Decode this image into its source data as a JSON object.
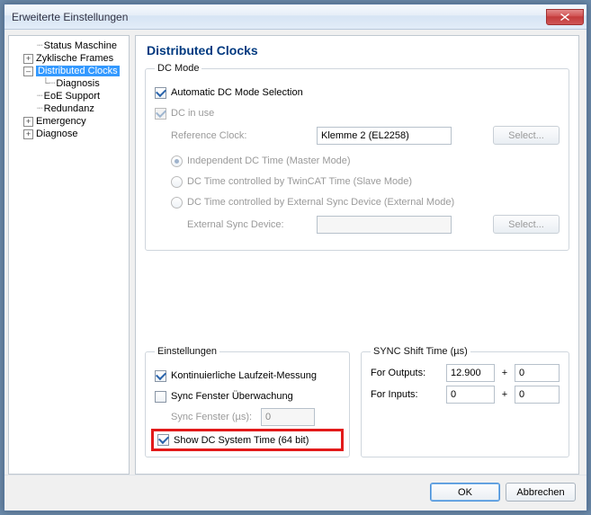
{
  "window": {
    "title": "Erweiterte Einstellungen"
  },
  "tree": {
    "items": [
      {
        "label": "Status Maschine"
      },
      {
        "label": "Zyklische Frames"
      },
      {
        "label": "Distributed Clocks"
      },
      {
        "label": "Diagnosis"
      },
      {
        "label": "EoE Support"
      },
      {
        "label": "Redundanz"
      },
      {
        "label": "Emergency"
      },
      {
        "label": "Diagnose"
      }
    ]
  },
  "page": {
    "title": "Distributed Clocks"
  },
  "dc_mode": {
    "legend": "DC Mode",
    "auto_label": "Automatic DC Mode Selection",
    "in_use_label": "DC in use",
    "ref_clock_label": "Reference Clock:",
    "ref_clock_value": "Klemme 2 (EL2258)",
    "select_label": "Select...",
    "opt_independent": "Independent DC Time (Master Mode)",
    "opt_twin": "DC Time controlled by TwinCAT Time (Slave Mode)",
    "opt_ext": "DC Time controlled by External Sync Device (External Mode)",
    "ext_device_label": "External Sync Device:",
    "ext_device_value": ""
  },
  "settings": {
    "legend": "Einstellungen",
    "cont_runtime": "Kontinuierliche Laufzeit-Messung",
    "sync_window_mon": "Sync Fenster Überwachung",
    "sync_window_label": "Sync Fenster (µs):",
    "sync_window_value": "0",
    "show_dc_64": "Show DC System Time (64 bit)"
  },
  "sync_shift": {
    "legend": "SYNC Shift Time (µs)",
    "outputs_label": "For Outputs:",
    "outputs_val": "12.900",
    "outputs_plus": "0",
    "inputs_label": "For Inputs:",
    "inputs_val": "0",
    "inputs_plus": "0"
  },
  "footer": {
    "ok": "OK",
    "cancel": "Abbrechen"
  }
}
